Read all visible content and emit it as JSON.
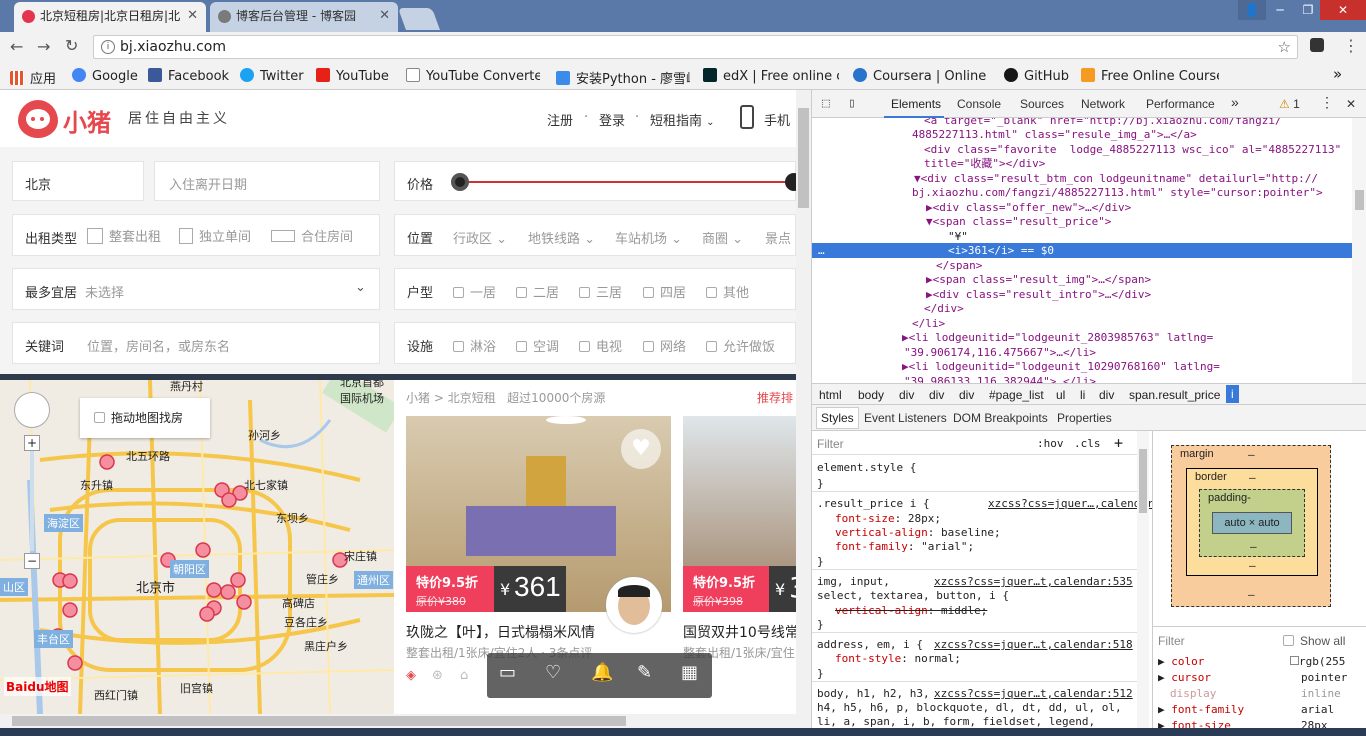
{
  "browser": {
    "tabs": [
      {
        "title": "北京短租房|北京日租房|北",
        "favicon_color": "#e3364e"
      },
      {
        "title": "博客后台管理 - 博客园",
        "favicon_color": "#7a7a7a"
      }
    ],
    "url": "bj.xiaozhu.com",
    "bookmarks": [
      {
        "label": "应用",
        "icon": "apps-icon",
        "color": "#e5562f"
      },
      {
        "label": "Google",
        "icon": "google-icon",
        "color": "#4285f4"
      },
      {
        "label": "Facebook",
        "icon": "facebook-icon",
        "color": "#3b5998"
      },
      {
        "label": "Twitter",
        "icon": "twitter-icon",
        "color": "#1da1f2"
      },
      {
        "label": "YouTube",
        "icon": "youtube-icon",
        "color": "#e62117"
      },
      {
        "label": "YouTube Converter",
        "icon": "page-icon",
        "color": "#ffffff"
      },
      {
        "label": "安装Python - 廖雪峰",
        "icon": "rocket-icon",
        "color": "#3b8beb"
      },
      {
        "label": "edX | Free online co",
        "icon": "edx-icon",
        "color": "#02262b"
      },
      {
        "label": "Coursera | Online C",
        "icon": "coursera-icon",
        "color": "#2a73cc"
      },
      {
        "label": "GitHub",
        "icon": "github-icon",
        "color": "#181717"
      },
      {
        "label": "Free Online Courses",
        "icon": "courses-icon",
        "color": "#f59a23"
      }
    ],
    "bookmarks_more": "»"
  },
  "site": {
    "brand": {
      "logo_text": "小猪",
      "slogan": "居住自由主义",
      "color": "#e5484d"
    },
    "nav": {
      "register": "注册",
      "sep1": "·",
      "login": "登录",
      "sep2": "·",
      "guide": "短租指南",
      "mobile": "手机"
    },
    "filters": {
      "city": "北京",
      "date_placeholder": "入住离开日期",
      "price_label": "价格",
      "rent_type_label": "出租类型",
      "rent_types": [
        "整套出租",
        "独立单间",
        "合住房间"
      ],
      "location_label": "位置",
      "locations": [
        "行政区",
        "地铁线路",
        "车站机场",
        "商圈",
        "景点"
      ],
      "guests_label": "最多宜居",
      "guests_value": "未选择",
      "rooms_label": "户型",
      "rooms": [
        "一居",
        "二居",
        "三居",
        "四居",
        "其他"
      ],
      "keyword_label": "关键词",
      "keyword_placeholder": "位置，房间名，或房东名",
      "facilities_label": "设施",
      "facilities": [
        "淋浴",
        "空调",
        "电视",
        "网络",
        "允许做饭"
      ]
    },
    "map": {
      "drag_search": "拖动地图找房",
      "labels": [
        "燕丹村",
        "北京首都国际机场",
        "北五环路",
        "东升镇",
        "北七家镇",
        "孙河乡",
        "东坝乡",
        "海淀区",
        "朝阳区",
        "管庄乡",
        "北京市",
        "通州区",
        "丰台区",
        "豆各庄乡",
        "黑庄户乡",
        "宋庄镇",
        "西红门镇",
        "旧宫镇",
        "高碑店",
        "山区"
      ],
      "baidu": "Baidu地图"
    },
    "breadcrumb": {
      "home": "小猪",
      "city": "北京短租",
      "count": "超过10000个房源",
      "recommend": "推荐排"
    },
    "listings": [
      {
        "badge": "特价9.5折",
        "orig": "原价¥380",
        "price_symbol": "¥",
        "price": "361",
        "title": "玖陇之【叶】，日式榻榻米风情",
        "meta": "整套出租/1张床/宜住2人 · 3条点评"
      },
      {
        "badge": "特价9.5折",
        "orig": "原价¥398",
        "price_symbol": "¥",
        "price": "3",
        "title": "国贸双井10号线常",
        "meta": "整套出租/1张床/宜住"
      }
    ],
    "colors": {
      "accent": "#e5484d",
      "badge": "#ef3f5c",
      "price_bg": "#3a3a3a"
    }
  },
  "devtools": {
    "tabs": [
      "Elements",
      "Console",
      "Sources",
      "Network",
      "Performance"
    ],
    "warning_count": "1",
    "more": "»",
    "dom_lines": [
      "<a target=\"_blank\" href=\"http://bj.xiaozhu.com/fangzi/",
      "4885227113.html\" class=\"resule_img_a\">…</a>",
      "<div class=\"favorite  lodge_4885227113 wsc_ico\" al=\"4885227113\"",
      "title=\"收藏\"></div>",
      "<div class=\"result_btm_con lodgeunitname\" detailurl=\"http://",
      "bj.xiaozhu.com/fangzi/4885227113.html\" style=\"cursor:pointer\">",
      "<div class=\"offer_new\">…</div>",
      "<span class=\"result_price\">",
      "\"¥\"",
      "<i>361</i> == $0",
      "</span>",
      "<span class=\"result_img\">…</span>",
      "<div class=\"result_intro\">…</div>",
      "</div>",
      "</li>",
      "<li lodgeunitid=\"lodgeunit_2803985763\" latlng=",
      "\"39.906174,116.475667\">…</li>",
      "<li lodgeunitid=\"lodgeunit_10290768160\" latlng=",
      "\"39.986133,116.382944\">…</li>"
    ],
    "crumbs": [
      "html",
      "body",
      "div",
      "div",
      "div",
      "#page_list",
      "ul",
      "li",
      "div",
      "span.result_price",
      "i"
    ],
    "style_tabs": [
      "Styles",
      "Event Listeners",
      "DOM Breakpoints",
      "Properties"
    ],
    "filter_placeholder": "Filter",
    "hov": ":hov",
    "cls": ".cls",
    "add": "+",
    "rules": [
      {
        "selector": "element.style {",
        "source": "",
        "decls": [],
        "close": "}"
      },
      {
        "selector": ".result_price i {",
        "source": "xzcss?css=jquer…,calendar:2502",
        "decls": [
          [
            "font-size",
            "28px;"
          ],
          [
            "vertical-align",
            "baseline;"
          ],
          [
            "font-family",
            "\"arial\";"
          ]
        ],
        "close": "}"
      },
      {
        "selector": "img, input,",
        "selector2": "select, textarea, button, i {",
        "source": "xzcss?css=jquer…t,calendar:535",
        "decls": [
          [
            "vertical-align",
            "middle;"
          ]
        ],
        "close": "}"
      },
      {
        "selector": "address, em, i {",
        "source": "xzcss?css=jquer…t,calendar:518",
        "decls": [
          [
            "font-style",
            "normal;"
          ]
        ],
        "close": "}"
      },
      {
        "selector": "body, h1, h2, h3,",
        "selector2": "h4, h5, h6, p, blockquote, dl, dt, dd, ul, ol,",
        "selector3": "li, a, span, i, b, form, fieldset, legend,",
        "source": "xzcss?css=jquer…t,calendar:512",
        "decls": [],
        "close": ""
      }
    ],
    "boxmodel": {
      "margin": "margin",
      "border": "border",
      "padding": "padding-",
      "content": "auto × auto",
      "dash": "–"
    },
    "computed_filter": "Filter",
    "show_all": "Show all",
    "computed": [
      {
        "name": "color",
        "value": "rgb(255"
      },
      {
        "name": "cursor",
        "value": "pointer"
      },
      {
        "name": "display",
        "value": "inline"
      },
      {
        "name": "font-family",
        "value": "arial"
      },
      {
        "name": "font-size",
        "value": "28px"
      }
    ]
  }
}
